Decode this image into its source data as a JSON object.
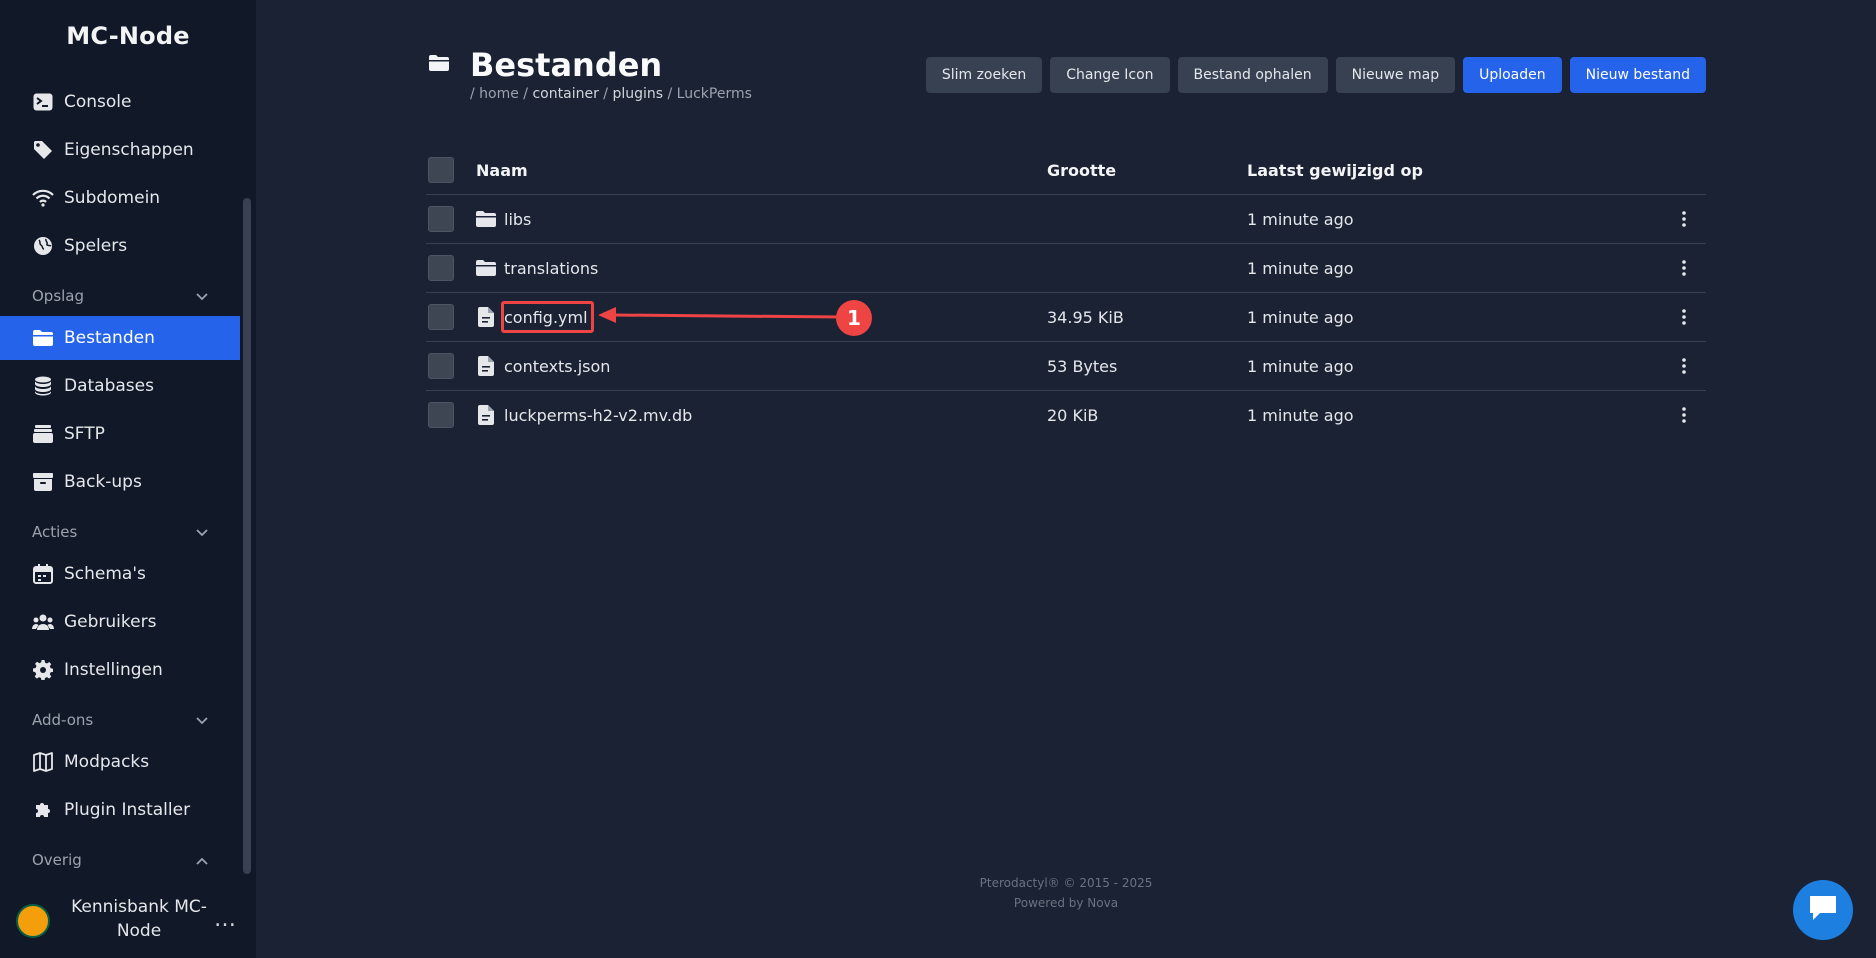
{
  "sidebar": {
    "brand": "MC-Node",
    "items": [
      {
        "label": "Console",
        "icon": "terminal-icon"
      },
      {
        "label": "Eigenschappen",
        "icon": "tag-icon"
      },
      {
        "label": "Subdomein",
        "icon": "wifi-icon"
      },
      {
        "label": "Spelers",
        "icon": "globe-icon"
      }
    ],
    "sections": [
      {
        "label": "Opslag",
        "expanded": true
      },
      {
        "label": "Acties",
        "expanded": true
      },
      {
        "label": "Add-ons",
        "expanded": true
      },
      {
        "label": "Overig",
        "expanded": false
      }
    ],
    "storage_items": [
      {
        "label": "Bestanden",
        "icon": "folder-icon",
        "active": true
      },
      {
        "label": "Databases",
        "icon": "database-icon"
      },
      {
        "label": "SFTP",
        "icon": "server-icon"
      },
      {
        "label": "Back-ups",
        "icon": "archive-icon"
      }
    ],
    "action_items": [
      {
        "label": "Schema's",
        "icon": "calendar-icon"
      },
      {
        "label": "Gebruikers",
        "icon": "users-icon"
      },
      {
        "label": "Instellingen",
        "icon": "gear-icon"
      }
    ],
    "addon_items": [
      {
        "label": "Modpacks",
        "icon": "map-icon"
      },
      {
        "label": "Plugin Installer",
        "icon": "puzzle-icon"
      }
    ],
    "user": {
      "name_line1": "Kennisbank MC-",
      "name_line2": "Node",
      "more": "…"
    }
  },
  "header": {
    "title": "Bestanden",
    "breadcrumb": {
      "root": "/ home /",
      "seg1": "container",
      "sep1": " / ",
      "seg2": "plugins",
      "sep2": " / ",
      "seg3": "LuckPerms"
    }
  },
  "toolbar": {
    "smart_search": "Slim zoeken",
    "change_icon": "Change Icon",
    "fetch_file": "Bestand ophalen",
    "new_folder": "Nieuwe map",
    "upload": "Uploaden",
    "new_file": "Nieuw bestand"
  },
  "table": {
    "headers": {
      "name": "Naam",
      "size": "Grootte",
      "modified": "Laatst gewijzigd op"
    },
    "rows": [
      {
        "name": "libs",
        "type": "folder",
        "size": "",
        "modified": "1 minute ago"
      },
      {
        "name": "translations",
        "type": "folder",
        "size": "",
        "modified": "1 minute ago"
      },
      {
        "name": "config.yml",
        "type": "file",
        "size": "34.95 KiB",
        "modified": "1 minute ago"
      },
      {
        "name": "contexts.json",
        "type": "file",
        "size": "53 Bytes",
        "modified": "1 minute ago"
      },
      {
        "name": "luckperms-h2-v2.mv.db",
        "type": "file",
        "size": "20 KiB",
        "modified": "1 minute ago"
      }
    ]
  },
  "annotation": {
    "number": "1",
    "color": "#ef4444"
  },
  "footer": {
    "line1": "Pterodactyl® © 2015 - 2025",
    "line2": "Powered by Nova"
  },
  "colors": {
    "accent": "#2563eb",
    "background": "#1a2233",
    "sidebar": "#111827",
    "annotation": "#ef4444"
  }
}
